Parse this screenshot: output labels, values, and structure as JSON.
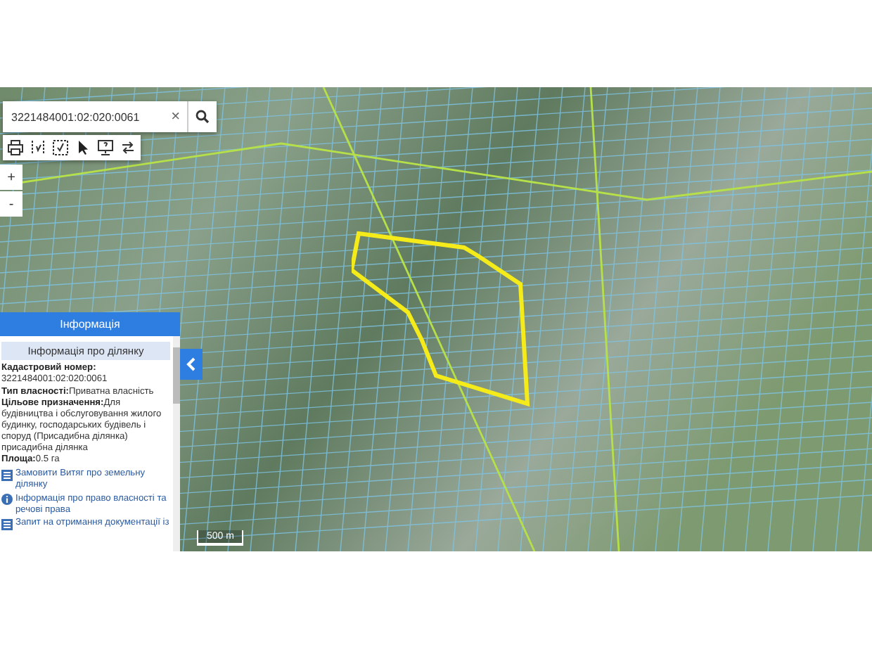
{
  "search": {
    "value": "3221484001:02:020:0061",
    "clear": "×"
  },
  "zoom": {
    "zoom_in": "+",
    "zoom_out": "-"
  },
  "info_panel": {
    "title": "Інформація",
    "subtitle": "Інформація про ділянку",
    "fields": [
      {
        "label": "Кадастровий номер:",
        "value": "3221484001:02:020:0061",
        "kind": "block"
      },
      {
        "label": "Тип власності:",
        "value": "Приватна власність",
        "kind": "inline"
      },
      {
        "label": "Цільове призначення:",
        "value": "Для будівництва і обслуговування жилого будинку, господарських будівель і споруд (Присадибна ділянка) присадибна ділянка",
        "kind": "inline"
      },
      {
        "label": "Площа:",
        "value": "0.5 га",
        "kind": "inline"
      }
    ],
    "links": [
      {
        "text": "Замовити Витяг про земельну ділянку",
        "kind": "document"
      },
      {
        "text": "Інформація про право власності та речові права",
        "kind": "info"
      },
      {
        "text": "Запит на отримання документації із",
        "kind": "document"
      }
    ]
  },
  "scale": "500 m"
}
